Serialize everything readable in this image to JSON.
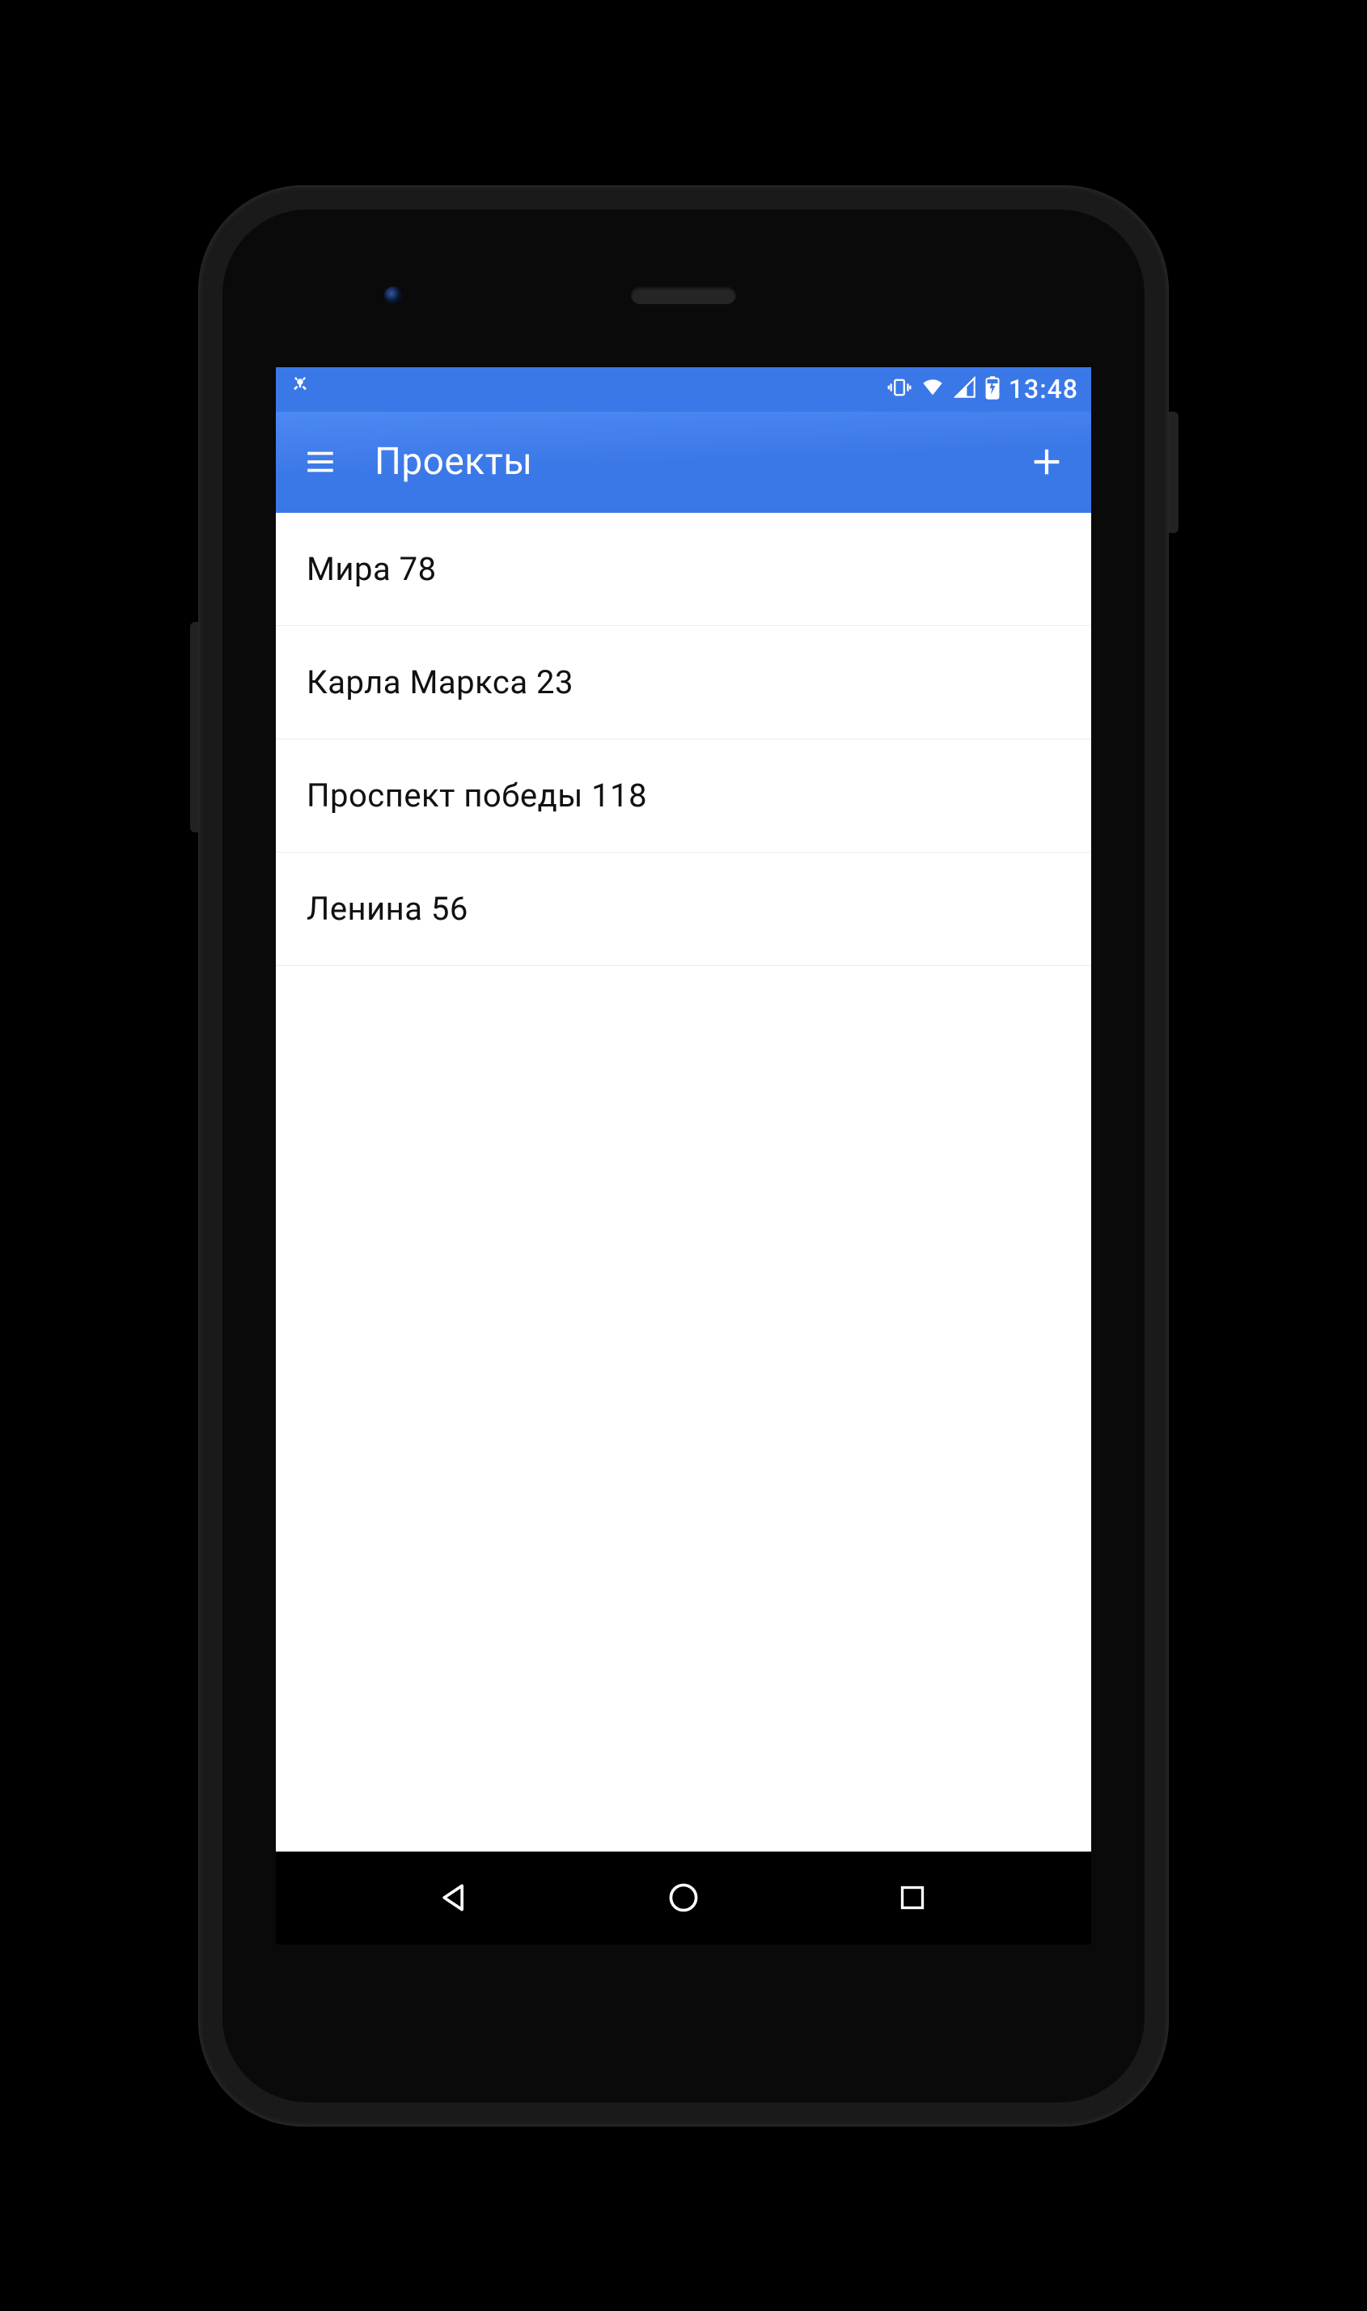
{
  "status": {
    "time": "13:48"
  },
  "appbar": {
    "title": "Проекты"
  },
  "projects": [
    {
      "name": "Мира 78"
    },
    {
      "name": "Карла Маркса 23"
    },
    {
      "name": "Проспект победы 118"
    },
    {
      "name": "Ленина 56"
    }
  ]
}
